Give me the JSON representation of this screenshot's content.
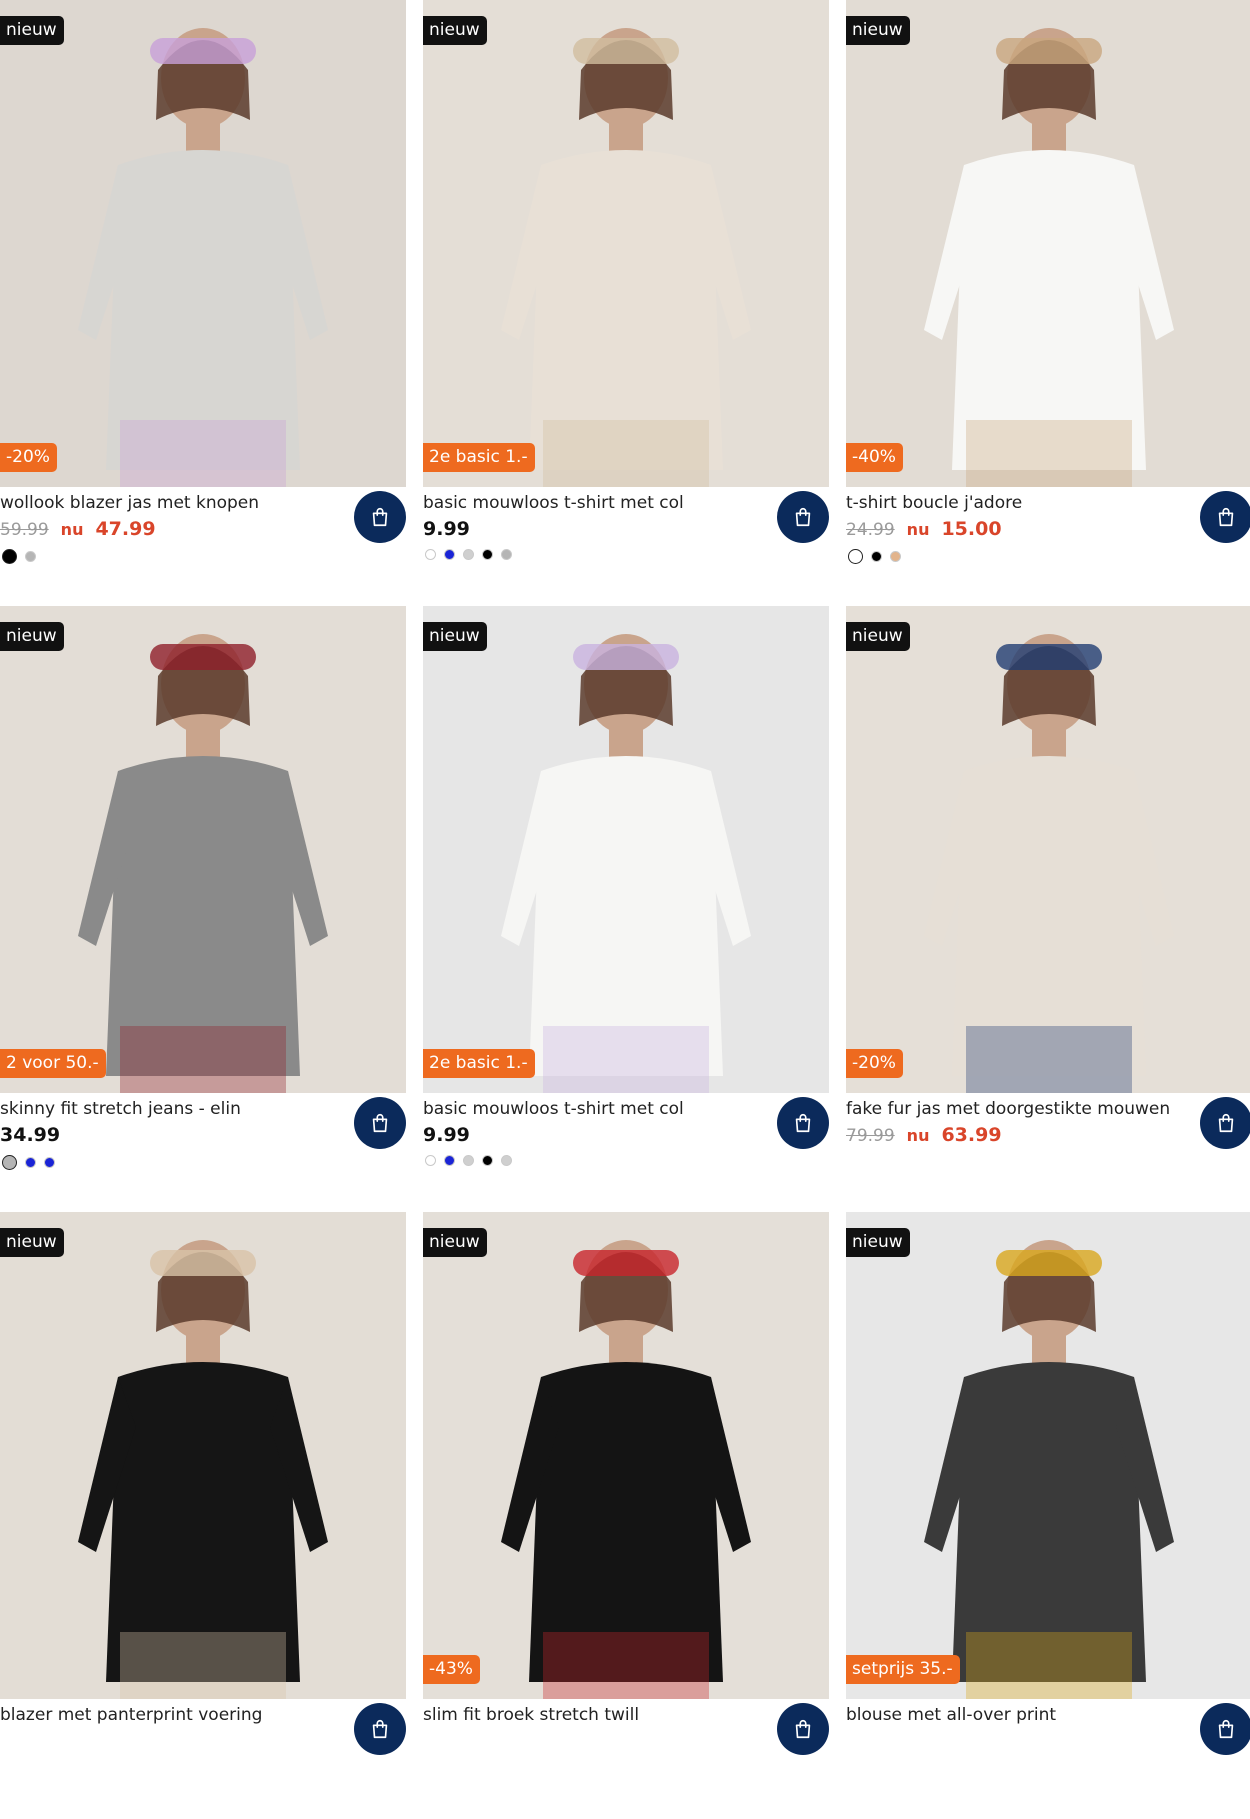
{
  "products": [
    {
      "title": "wollook blazer jas met knopen",
      "badge": "nieuw",
      "promo": "-20%",
      "old_price": "59.99",
      "now_prefix": "nu",
      "price": "47.99",
      "swatches": [
        "#000000",
        "#b5b5b5"
      ],
      "bg": "#ddd7d0",
      "garment": "#d7d6d2",
      "accent": "#c8a0d8",
      "icon": "shopping-bag-icon"
    },
    {
      "title": "basic mouwloos t-shirt met col",
      "badge": "nieuw",
      "promo": "2e basic 1.-",
      "old_price": "",
      "now_prefix": "",
      "price": "9.99",
      "swatches": [
        "#ffffff",
        "#1a24d6",
        "#cfcfcf",
        "#000000",
        "#b5b5b5"
      ],
      "bg": "#e4ded6",
      "garment": "#e8e0d6",
      "accent": "#d1bd9f",
      "icon": "shopping-bag-icon"
    },
    {
      "title": "t-shirt boucle j'adore",
      "badge": "nieuw",
      "promo": "-40%",
      "old_price": "24.99",
      "now_prefix": "nu",
      "price": "15.00",
      "swatches": [
        "#ffffff",
        "#000000",
        "#e2b48c"
      ],
      "bg": "#e2dcd4",
      "garment": "#f7f7f5",
      "accent": "#c9a67e",
      "icon": "shopping-bag-icon"
    },
    {
      "title": "skinny fit stretch jeans - elin",
      "badge": "nieuw",
      "promo": "2 voor 50.-",
      "old_price": "",
      "now_prefix": "",
      "price": "34.99",
      "swatches": [
        "#b5b5b5",
        "#1a24d6",
        "#1a24d6"
      ],
      "bg": "#e3ddd6",
      "garment": "#8a8a8a",
      "accent": "#8e1f2a",
      "icon": "shopping-bag-icon"
    },
    {
      "title": "basic mouwloos t-shirt met col",
      "badge": "nieuw",
      "promo": "2e basic 1.-",
      "old_price": "",
      "now_prefix": "",
      "price": "9.99",
      "swatches": [
        "#ffffff",
        "#1a24d6",
        "#cfcfcf",
        "#000000",
        "#cfcfcf"
      ],
      "bg": "#e6e6e6",
      "garment": "#f6f6f4",
      "accent": "#c9b3e0",
      "icon": "shopping-bag-icon"
    },
    {
      "title": "fake fur jas met doorgestikte mouwen",
      "badge": "nieuw",
      "promo": "-20%",
      "old_price": "79.99",
      "now_prefix": "nu",
      "price": "63.99",
      "swatches": [],
      "bg": "#e5dfd7",
      "garment": "#e6dfd6",
      "accent": "#223d73",
      "icon": "shopping-bag-icon"
    },
    {
      "title": "blazer met panterprint voering",
      "badge": "nieuw",
      "promo": "",
      "old_price": "",
      "now_prefix": "",
      "price": "",
      "swatches": [],
      "bg": "#e3ddd5",
      "garment": "#151515",
      "accent": "#d8c3a8",
      "icon": "shopping-bag-icon"
    },
    {
      "title": "slim fit broek stretch twill",
      "badge": "nieuw",
      "promo": "-43%",
      "old_price": "",
      "now_prefix": "",
      "price": "",
      "swatches": [],
      "bg": "#e4dfd8",
      "garment": "#141414",
      "accent": "#c8242c",
      "icon": "shopping-bag-icon"
    },
    {
      "title": "blouse met all-over print",
      "badge": "nieuw",
      "promo": "setprijs 35.-",
      "old_price": "",
      "now_prefix": "",
      "price": "",
      "swatches": [],
      "bg": "#e7e7e7",
      "garment": "#3a3a3a",
      "accent": "#d9a81e",
      "icon": "shopping-bag-icon"
    }
  ]
}
